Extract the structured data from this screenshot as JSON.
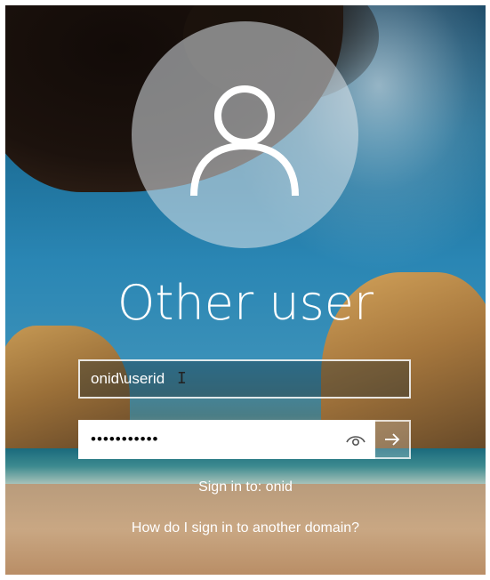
{
  "login": {
    "user_display_name": "Other user",
    "username": {
      "value": "onid\\userid"
    },
    "password": {
      "masked_value": "•••••••••••"
    },
    "sign_in_to": "Sign in to: onid",
    "other_domain_link": "How do I sign in to another domain?"
  },
  "icons": {
    "avatar": "user-avatar-icon",
    "reveal": "eye-icon",
    "submit": "arrow-right-icon",
    "cursor": "text-cursor-icon"
  },
  "colors": {
    "text": "#ffffff",
    "field_border": "#ffffff",
    "password_bg": "#ffffff"
  }
}
